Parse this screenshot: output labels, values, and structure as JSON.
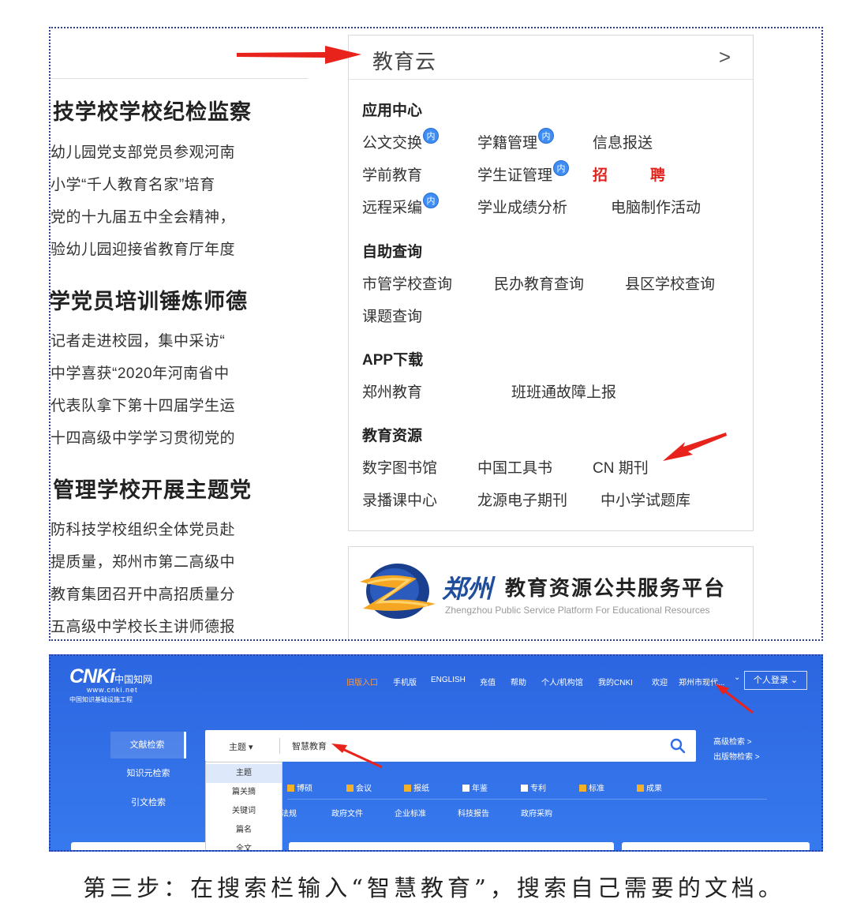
{
  "news": {
    "headlines": [
      "技学校学校纪检监察",
      "学党员培训锤炼师德",
      "管理学校开展主题党"
    ],
    "lines": [
      "幼儿园党支部党员参观河南",
      "小学“千人教育名家”培育",
      "党的十九届五中全会精神，",
      "验幼儿园迎接省教育厅年度",
      "记者走进校园，集中采访“",
      "中学喜获“2020年河南省中",
      "代表队拿下第十四届学生运",
      "十四高级中学学习贯彻党的",
      "防科技学校组织全体党员赴",
      "提质量，郑州市第二高级中",
      "教育集团召开中高招质量分",
      "五高级中学校长主讲师德报"
    ]
  },
  "edu_cloud": {
    "title": "教育云",
    "chevron": ">",
    "badge": "内",
    "sections": [
      {
        "title": "应用中心",
        "items": [
          "公文交换",
          "学籍管理",
          "信息报送",
          "学前教育",
          "学生证管理",
          "招",
          "聘",
          "远程采编",
          "学业成绩分析",
          "电脑制作活动"
        ]
      },
      {
        "title": "自助查询",
        "items": [
          "市管学校查询",
          "民办教育查询",
          "县区学校查询",
          "课题查询"
        ]
      },
      {
        "title": "APP下载",
        "items": [
          "郑州教育",
          "班班通故障上报"
        ]
      },
      {
        "title": "教育资源",
        "items": [
          "数字图书馆",
          "中国工具书",
          "CN 期刊",
          "录播课中心",
          "龙源电子期刊",
          "中小学试题库"
        ]
      }
    ]
  },
  "platform": {
    "name": "郑州",
    "title": "教育资源公共服务平台",
    "subtitle": "Zhengzhou Public Service Platform For Educational Resources"
  },
  "cnki": {
    "logo_main": "CNKi",
    "logo_cn": "中国知网",
    "logo_url": "www.cnki.net",
    "logo_tag": "中国知识基础设施工程",
    "nav": [
      "旧版入口",
      "手机版",
      "ENGLISH",
      "充值",
      "帮助",
      "个人/机构馆",
      "我的CNKI",
      "欢迎",
      "郑州市现代..."
    ],
    "nav_caret": "⌄",
    "login": "个人登录 ⌄",
    "left_tabs": [
      "文献检索",
      "知识元检索",
      "引文检索"
    ],
    "search_type": "主题 ▾",
    "search_value": "智慧教育",
    "adv_search": "高级检索  >",
    "pub_search": "出版物检索  >",
    "dropdown": [
      "主题",
      "篇关摘",
      "关键词",
      "篇名",
      "全文"
    ],
    "checkboxes": [
      "博硕",
      "会议",
      "报纸",
      "年鉴",
      "专利",
      "标准",
      "成果"
    ],
    "categories": [
      "法规",
      "政府文件",
      "企业标准",
      "科技报告",
      "政府采购"
    ]
  },
  "caption": "第三步：在搜索栏输入“智慧教育”，搜索自己需要的文档。",
  "colors": {
    "cnki_blue": "#2f6ee8",
    "arrow_red": "#e8231c",
    "badge_blue": "#3d8df5",
    "nav_orange": "#ff9a3a",
    "checkbox_yellow": "#f4b02b"
  }
}
